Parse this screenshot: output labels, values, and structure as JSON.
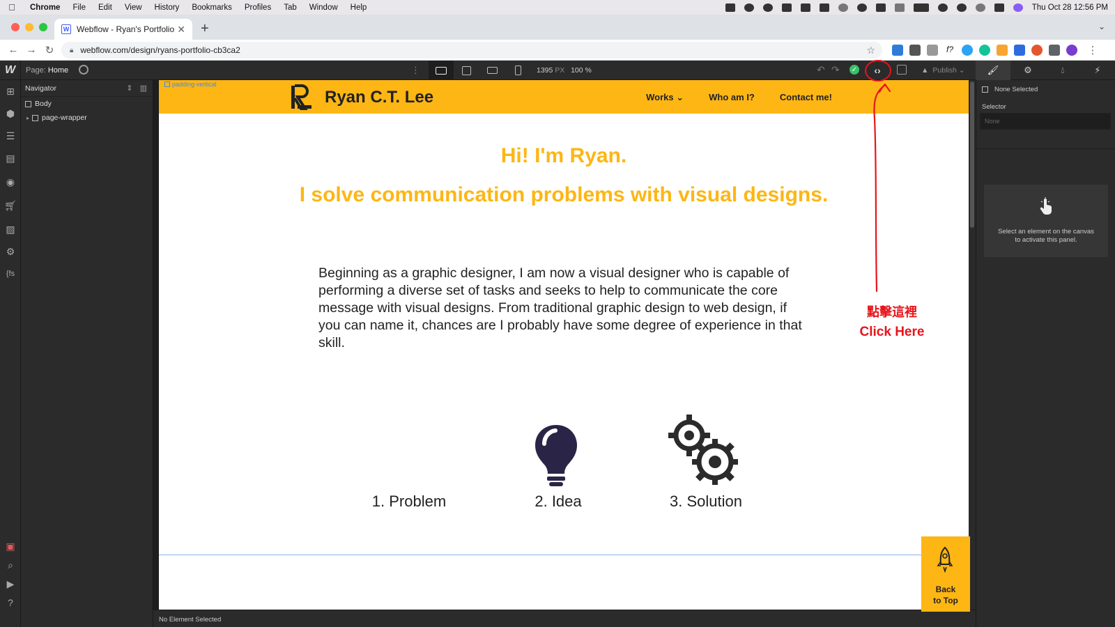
{
  "menubar": {
    "app": "Chrome",
    "items": [
      "File",
      "Edit",
      "View",
      "History",
      "Bookmarks",
      "Profiles",
      "Tab",
      "Window",
      "Help"
    ],
    "clock": "Thu Oct 28  12:56 PM"
  },
  "browser": {
    "tab_title": "Webflow - Ryan's Portfolio",
    "favicon_letter": "W",
    "url": "webflow.com/design/ryans-portfolio-cb3ca2"
  },
  "designer": {
    "page_label": "Page:",
    "page_name": "Home",
    "canvas_width": "1395",
    "canvas_unit": "PX",
    "zoom": "100 %",
    "publish_label": "Publish",
    "navigator_title": "Navigator",
    "tree": [
      "Body",
      "page-wrapper"
    ],
    "padding_label": "padding-vertical",
    "status_text": "No Element Selected"
  },
  "site": {
    "brand": "Ryan C.T. Lee",
    "nav": [
      "Works",
      "Who am I?",
      "Contact me!"
    ],
    "hero_line1": "Hi! I'm Ryan.",
    "hero_line2": "I solve communication problems with visual designs.",
    "body": "Beginning as a graphic designer, I am now a visual designer who is capable of performing a diverse set of tasks and seeks to help to communicate the core message with visual designs. From traditional graphic design to web design, if you can name it, chances are I probably have some degree of experience in that skill.",
    "features": [
      "1. Problem",
      "2. Idea",
      "3. Solution"
    ],
    "back_to_top_1": "Back",
    "back_to_top_2": "to Top"
  },
  "right_panel": {
    "none_selected": "None Selected",
    "selector_label": "Selector",
    "selector_placeholder": "None",
    "empty_line1": "Select an element on the canvas",
    "empty_line2": "to activate this panel."
  },
  "annotation": {
    "chinese": "點擊這裡",
    "english": "Click Here",
    "color": "#e8141c"
  },
  "colors": {
    "brand_yellow": "#fdb614",
    "designer_bg": "#2b2b2b",
    "selection_blue": "#3b8bff"
  }
}
